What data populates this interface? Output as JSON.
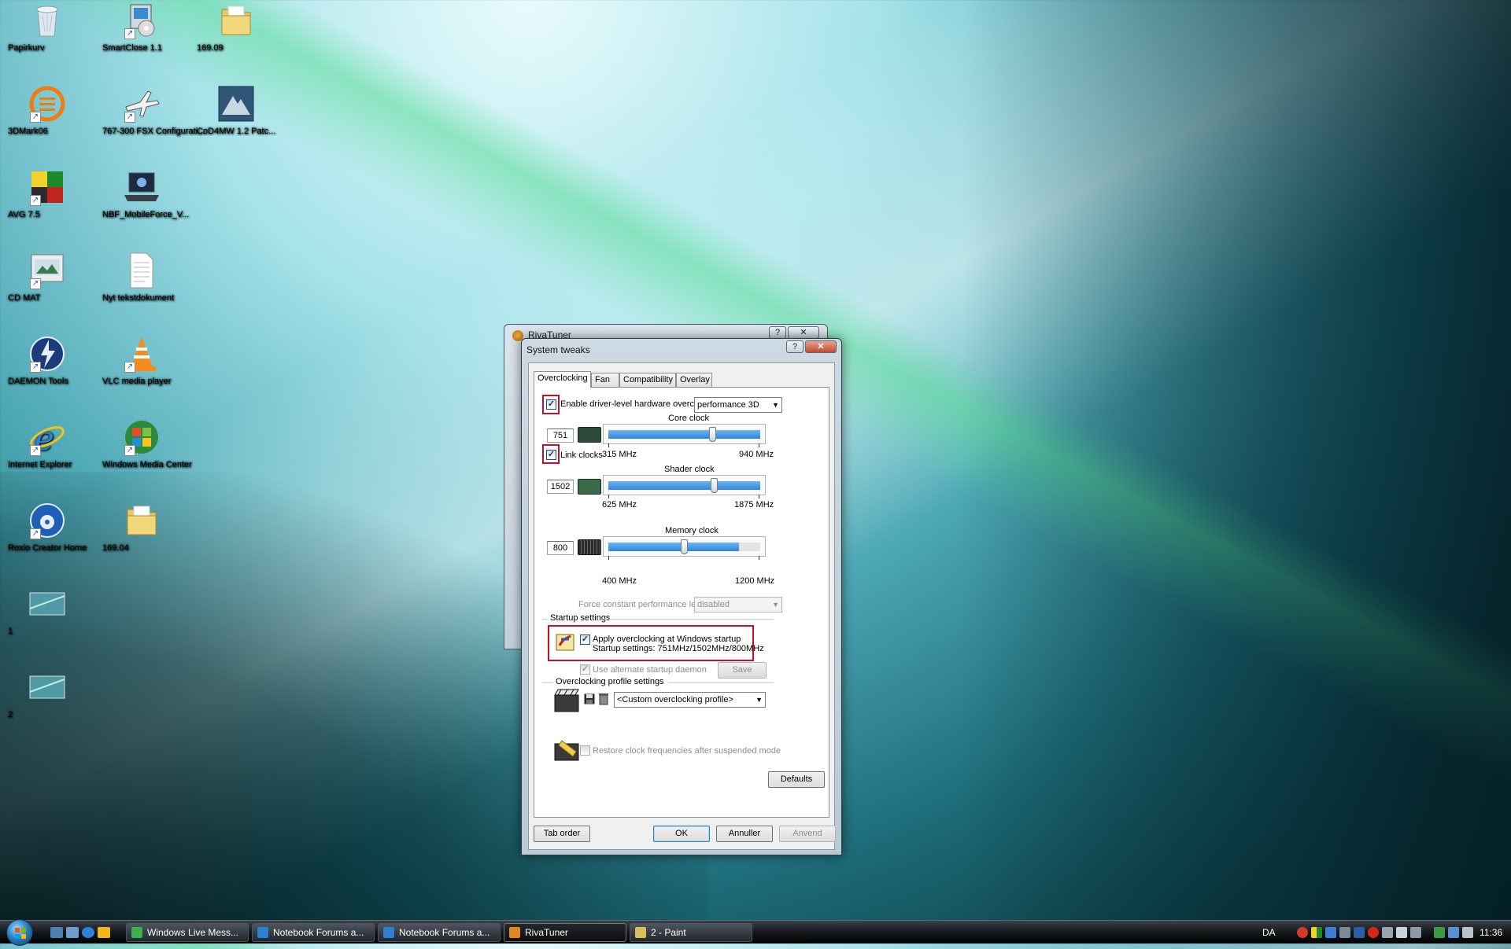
{
  "desktop": {
    "icons": [
      {
        "label": "Papirkurv",
        "icon": "recycle-bin-icon"
      },
      {
        "label": "SmartClose 1.1",
        "icon": "installer-icon"
      },
      {
        "label": "169.09",
        "icon": "folder-icon"
      },
      {
        "label": "3DMark06",
        "icon": "3dmark-icon"
      },
      {
        "label": "767-300 FSX Configurati...",
        "icon": "airplane-icon"
      },
      {
        "label": "CoD4MW 1.2 Patc...",
        "icon": "cod4-icon"
      },
      {
        "label": "AVG 7.5",
        "icon": "avg-icon"
      },
      {
        "label": "NBF_MobileForce_V...",
        "icon": "laptop-icon"
      },
      {
        "label": "CD MAT",
        "icon": "cd-mat-icon"
      },
      {
        "label": "Nyt tekstdokument",
        "icon": "text-document-icon"
      },
      {
        "label": "DAEMON Tools",
        "icon": "daemon-tools-icon"
      },
      {
        "label": "VLC media player",
        "icon": "vlc-icon"
      },
      {
        "label": "Internet Explorer",
        "icon": "internet-explorer-icon"
      },
      {
        "label": "Windows Media Center",
        "icon": "media-center-icon"
      },
      {
        "label": "Roxio Creator Home",
        "icon": "roxio-icon"
      },
      {
        "label": "169.04",
        "icon": "folder-icon"
      },
      {
        "label": "1",
        "icon": "image-thumbnail-icon"
      },
      {
        "label": "2",
        "icon": "image-thumbnail-icon"
      }
    ]
  },
  "back_window": {
    "title": "RivaTuner",
    "help": "?",
    "close": "✕"
  },
  "dialog": {
    "title": "System tweaks",
    "help": "?",
    "close": "✕",
    "tabs": [
      "Overclocking",
      "Fan",
      "Compatibility",
      "Overlay"
    ],
    "enable_oc": {
      "label": "Enable driver-level hardware overclocking",
      "checked": "✓"
    },
    "mode_select": "performance 3D",
    "core": {
      "title": "Core clock",
      "value": "751",
      "min": "315 MHz",
      "max": "940 MHz",
      "fraction": 0.69
    },
    "link_clocks": {
      "label": "Link clocks",
      "checked": "✓"
    },
    "shader": {
      "title": "Shader clock",
      "value": "1502",
      "min": "625 MHz",
      "max": "1875 MHz",
      "fraction": 0.7
    },
    "memory": {
      "title": "Memory clock",
      "value": "800",
      "min": "400 MHz",
      "max": "1200 MHz",
      "fraction": 0.5,
      "fill_fraction": 0.86
    },
    "force_perf": {
      "label": "Force constant performance level",
      "value": "disabled"
    },
    "startup": {
      "section": "Startup settings",
      "apply_label": "Apply overclocking at Windows startup",
      "apply_checked": "✓",
      "summary": "Startup settings: 751MHz/1502MHz/800MHz",
      "daemon_label": "Use alternate startup daemon",
      "daemon_checked": "✓",
      "save": "Save"
    },
    "profile": {
      "section": "Overclocking profile settings",
      "value": "<Custom overclocking profile>"
    },
    "restore": {
      "label": "Restore clock frequencies after suspended mode"
    },
    "defaults": "Defaults",
    "tab_order": "Tab order",
    "ok": "OK",
    "cancel": "Annuller",
    "apply": "Anvend"
  },
  "taskbar": {
    "buttons": [
      {
        "label": "Windows Live Mess...",
        "color": "#3fae4c"
      },
      {
        "label": "Notebook Forums a...",
        "color": "#2d7fd0"
      },
      {
        "label": "Notebook Forums a...",
        "color": "#2d7fd0"
      },
      {
        "label": "RivaTuner",
        "color": "#e08a1e"
      },
      {
        "label": "2 - Paint",
        "color": "#d9c05a"
      }
    ],
    "language": "DA",
    "clock": "11:36"
  }
}
